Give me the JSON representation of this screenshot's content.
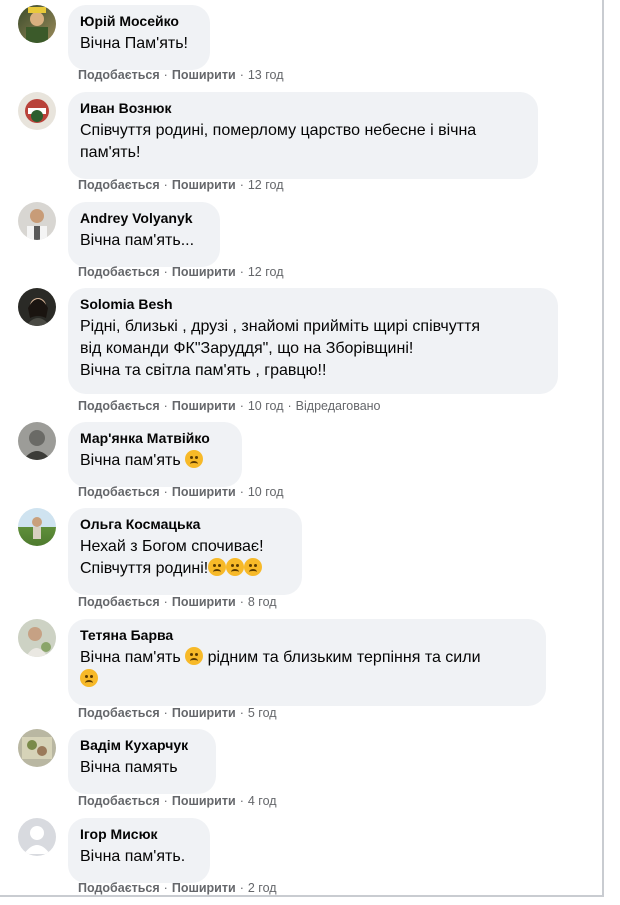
{
  "labels": {
    "like": "Подобається",
    "share": "Поширити"
  },
  "colors": {
    "bubble": "#f0f2f5",
    "text": "#050505",
    "meta": "#65676b",
    "emoji": "#f7b928"
  },
  "comments": [
    {
      "author": "Юрій Мосейко",
      "text": "Вічна Пам'ять!",
      "time": "13 год"
    },
    {
      "author": "Иван Вознюк",
      "text": "Співчуття родині, померлому царство небесне і вічна\nпам'ять!",
      "time": "12 год"
    },
    {
      "author": "Andrey Volyanyk",
      "text": "Вічна пам'ять...",
      "time": "12 год"
    },
    {
      "author": "Solomia Besh",
      "text": "Рідні, близькі , друзі , знайомі прийміть щирі співчуття\nвід команди ФК\"Заруддя\", що на Зборівщині!\nВічна та світла пам'ять , гравцю!!",
      "time": "10 год",
      "edited": "Відредаговано"
    },
    {
      "author": "Мар'янка Матвійко",
      "text": "Вічна пам'ять",
      "time": "10 год"
    },
    {
      "author": "Ольга Космацька",
      "text_line1": "Нехай з Богом спочиває!",
      "text_line2": "Співчуття родині!",
      "time": "8 год"
    },
    {
      "author": "Тетяна Барва",
      "text_part1": "Вічна пам'ять",
      "text_part2": "рідним та близьким терпіння та сили",
      "time": "5 год"
    },
    {
      "author": "Вадім Кухарчук",
      "text": "Вічна память",
      "time": "4 год"
    },
    {
      "author": "Ігор Мисюк",
      "text": "Вічна пам'ять.",
      "time": "2 год"
    }
  ]
}
